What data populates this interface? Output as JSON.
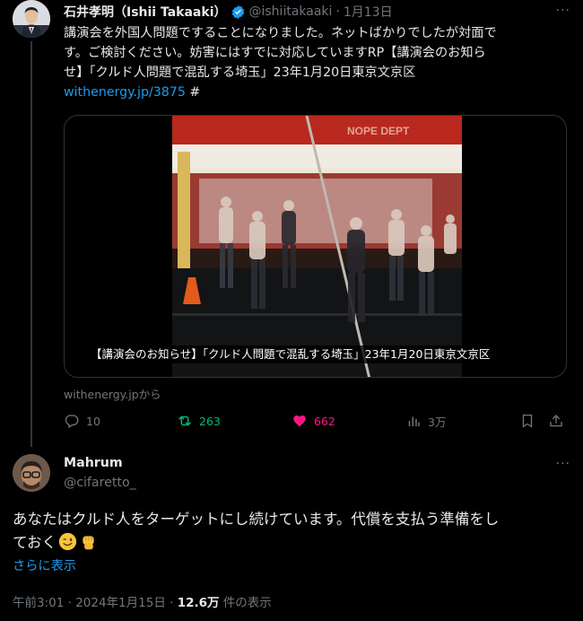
{
  "parent_tweet": {
    "author_name": "石井孝明（Ishii Takaaki）",
    "handle": "@ishiitakaaki",
    "separator": "·",
    "date": "1月13日",
    "more": "···",
    "text_lines": [
      "講演会を外国人問題ですることになりました。ネットばかりでしたが対面で",
      "す。ご検討ください。妨害にはすでに対応していますRP【講演会のお知ら",
      "せ】「クルド人問題で混乱する埼玉」23年1月20日東京文京区"
    ],
    "link_text": "withenergy.jp/3875",
    "hashtag_suffix": " #",
    "card": {
      "title_overlay": "【講演会のお知らせ】「クルド人問題で混乱する埼玉」23年1月20日東京文京区",
      "source": "withenergy.jpから",
      "sign_text": "NOPE DEPT"
    },
    "actions": {
      "replies": "10",
      "reposts": "263",
      "likes": "662",
      "views": "3万"
    }
  },
  "reply_tweet": {
    "author_name": "Mahrum",
    "handle": "@cifaretto_",
    "more": "···",
    "text_line1": "あなたはクルド人をターゲットにし続けています。代償を支払う準備をし",
    "text_line2": "ておく",
    "show_more": "さらに表示",
    "time": "午前3:01",
    "sep1": " · ",
    "date": "2024年1月15日",
    "sep2": " · ",
    "views_count": "12.6万",
    "views_label": " 件の表示"
  },
  "colors": {
    "background": "#000000",
    "text": "#e7e9ea",
    "muted": "#71767b",
    "link": "#1d9bf0",
    "repost_green": "#00ba7c",
    "like_pink": "#f91880",
    "verified_blue": "#1d9bf0"
  },
  "icons": [
    "verified-badge-icon",
    "reply-icon",
    "repost-icon",
    "like-icon",
    "views-icon",
    "bookmark-icon",
    "share-icon",
    "winking-face-emoji",
    "raised-fist-emoji"
  ]
}
